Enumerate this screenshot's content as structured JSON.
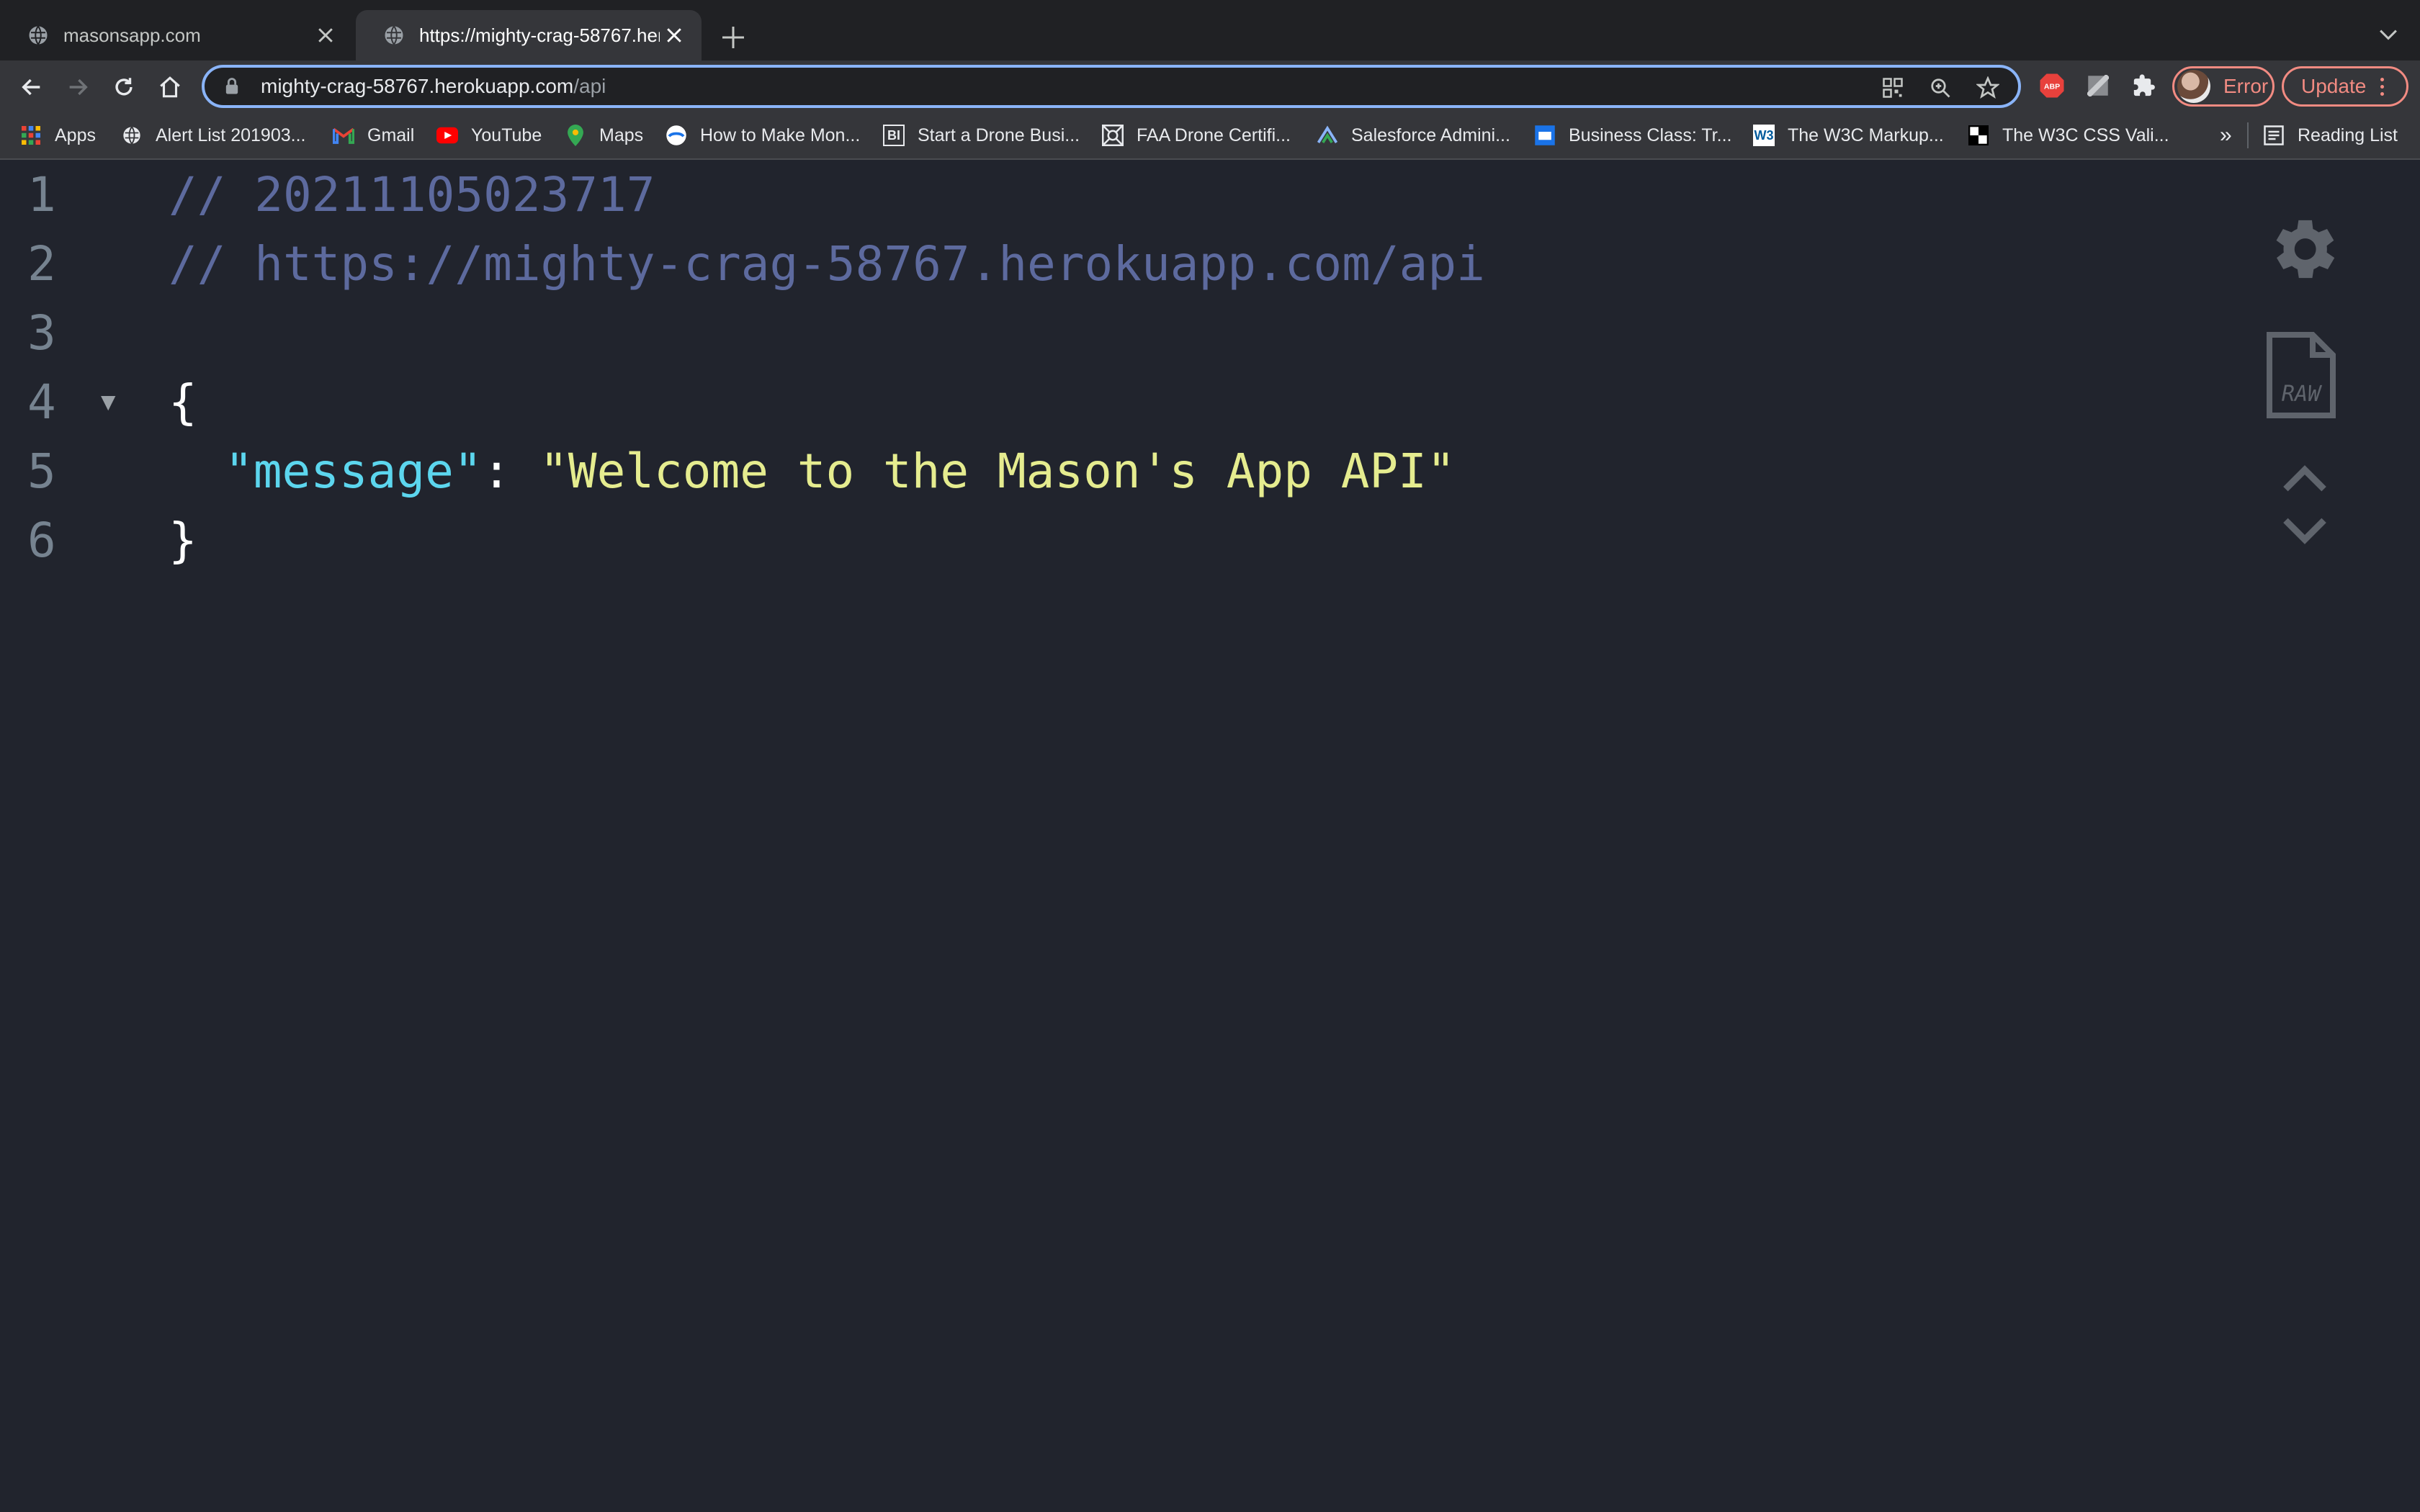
{
  "tabs": [
    {
      "title": "masonsapp.com",
      "active": false
    },
    {
      "title": "https://mighty-crag-58767.herokuapp.com/api",
      "active": true
    }
  ],
  "omnibox": {
    "host": "mighty-crag-58767.herokuapp.com",
    "path": "/api"
  },
  "profile": {
    "status": "Error"
  },
  "update_label": "Update",
  "bookmarks": [
    {
      "label": "Apps",
      "icon": "apps-grid-icon"
    },
    {
      "label": "Alert List 201903...",
      "icon": "globe-icon"
    },
    {
      "label": "Gmail",
      "icon": "gmail-icon"
    },
    {
      "label": "YouTube",
      "icon": "youtube-icon"
    },
    {
      "label": "Maps",
      "icon": "maps-pin-icon"
    },
    {
      "label": "How to Make Mon...",
      "icon": "site-logo-icon"
    },
    {
      "label": "Start a Drone Busi...",
      "icon": "bi-logo-icon"
    },
    {
      "label": "FAA Drone Certifi...",
      "icon": "faa-logo-icon"
    },
    {
      "label": "Salesforce Admini...",
      "icon": "salesforce-logo-icon"
    },
    {
      "label": "Business Class: Tr...",
      "icon": "business-logo-icon"
    },
    {
      "label": "The W3C Markup...",
      "icon": "w3c-logo-icon"
    },
    {
      "label": "The W3C CSS Vali...",
      "icon": "w3c-css-logo-icon"
    }
  ],
  "bookmarks_overflow": "»",
  "reading_list": "Reading List",
  "json_viewer": {
    "lines": [
      {
        "num": "1",
        "text": "// 20211105023717"
      },
      {
        "num": "2",
        "text": "// https://mighty-crag-58767.herokuapp.com/api"
      },
      {
        "num": "3",
        "text": ""
      },
      {
        "num": "4",
        "text": "{"
      },
      {
        "num": "5",
        "key": "\"message\"",
        "colon": ": ",
        "value": "\"Welcome to the Mason's App API\""
      },
      {
        "num": "6",
        "text": "}"
      }
    ],
    "fold_glyph": "▼"
  },
  "colors": {
    "background": "#21242d",
    "comment": "#5d6a9e",
    "key": "#5cd6ee",
    "string": "#e5ec8f",
    "accent_focus": "#8ab4f8",
    "error": "#f28b82"
  }
}
